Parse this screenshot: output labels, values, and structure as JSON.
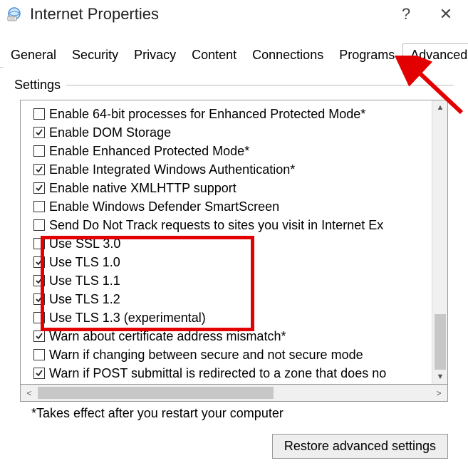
{
  "window": {
    "title": "Internet Properties",
    "help_symbol": "?",
    "close_symbol": "✕"
  },
  "tabs": [
    {
      "label": "General",
      "active": false
    },
    {
      "label": "Security",
      "active": false
    },
    {
      "label": "Privacy",
      "active": false
    },
    {
      "label": "Content",
      "active": false
    },
    {
      "label": "Connections",
      "active": false
    },
    {
      "label": "Programs",
      "active": false
    },
    {
      "label": "Advanced",
      "active": true
    }
  ],
  "group_label": "Settings",
  "settings": [
    {
      "label": "Enable 64-bit processes for Enhanced Protected Mode*",
      "checked": false
    },
    {
      "label": "Enable DOM Storage",
      "checked": true
    },
    {
      "label": "Enable Enhanced Protected Mode*",
      "checked": false
    },
    {
      "label": "Enable Integrated Windows Authentication*",
      "checked": true
    },
    {
      "label": "Enable native XMLHTTP support",
      "checked": true
    },
    {
      "label": "Enable Windows Defender SmartScreen",
      "checked": false
    },
    {
      "label": "Send Do Not Track requests to sites you visit in Internet Ex",
      "checked": false
    },
    {
      "label": "Use SSL 3.0",
      "checked": false
    },
    {
      "label": "Use TLS 1.0",
      "checked": true
    },
    {
      "label": "Use TLS 1.1",
      "checked": true
    },
    {
      "label": "Use TLS 1.2",
      "checked": true
    },
    {
      "label": "Use TLS 1.3 (experimental)",
      "checked": false
    },
    {
      "label": "Warn about certificate address mismatch*",
      "checked": true
    },
    {
      "label": "Warn if changing between secure and not secure mode",
      "checked": false
    },
    {
      "label": "Warn if POST submittal is redirected to a zone that does no",
      "checked": true
    }
  ],
  "footnote": "*Takes effect after you restart your computer",
  "restore_button": "Restore advanced settings",
  "annotation": {
    "highlight_start_index": 7,
    "highlight_end_index": 11,
    "arrow_target_tab": "Advanced",
    "colors": {
      "red": "#e30000"
    }
  }
}
